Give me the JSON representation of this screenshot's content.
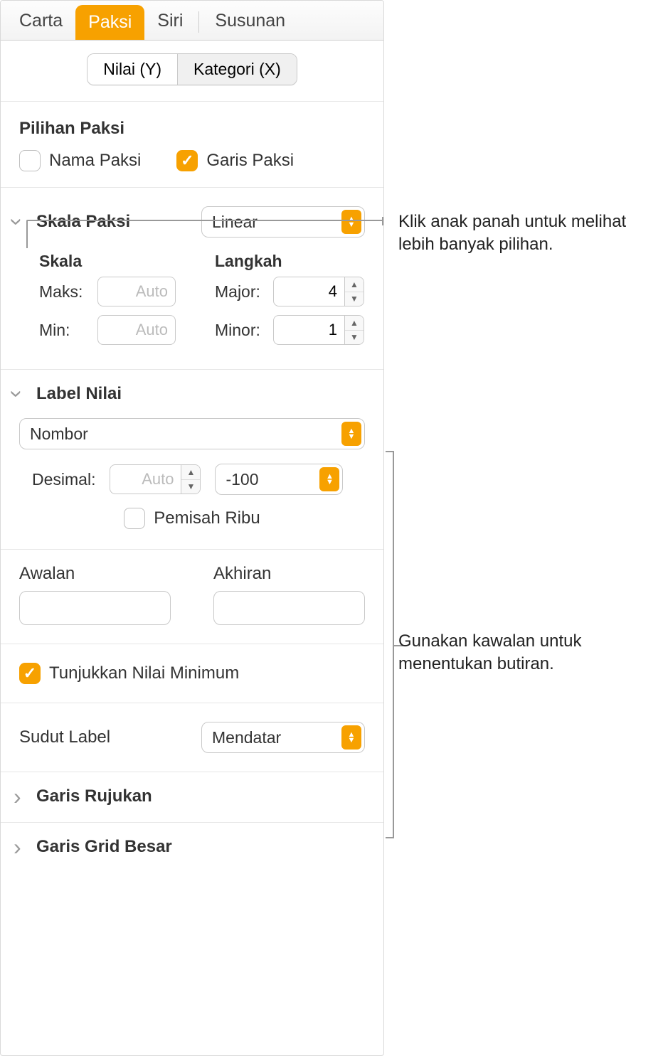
{
  "tabs": {
    "chart": "Carta",
    "axis": "Paksi",
    "series": "Siri",
    "arrange": "Susunan"
  },
  "seg": {
    "value": "Nilai (Y)",
    "category": "Kategori (X)"
  },
  "axis_options": {
    "title": "Pilihan Paksi",
    "axis_name": "Nama Paksi",
    "axis_line": "Garis Paksi"
  },
  "axis_scale": {
    "title": "Skala Paksi",
    "type": "Linear",
    "scale_label": "Skala",
    "steps_label": "Langkah",
    "max_label": "Maks:",
    "min_label": "Min:",
    "auto_placeholder": "Auto",
    "major_label": "Major:",
    "major_value": "4",
    "minor_label": "Minor:",
    "minor_value": "1"
  },
  "value_labels": {
    "title": "Label Nilai",
    "format": "Nombor",
    "decimals_label": "Desimal:",
    "decimals_placeholder": "Auto",
    "neg_format": "-100",
    "thousands": "Pemisah Ribu",
    "prefix_label": "Awalan",
    "suffix_label": "Akhiran",
    "show_min": "Tunjukkan Nilai Minimum",
    "angle_label": "Sudut Label",
    "angle_value": "Mendatar"
  },
  "ref_lines": "Garis Rujukan",
  "major_grid": "Garis Grid Besar",
  "callouts": {
    "c1": "Klik anak panah untuk melihat lebih banyak pilihan.",
    "c2": "Gunakan kawalan untuk menentukan butiran."
  }
}
